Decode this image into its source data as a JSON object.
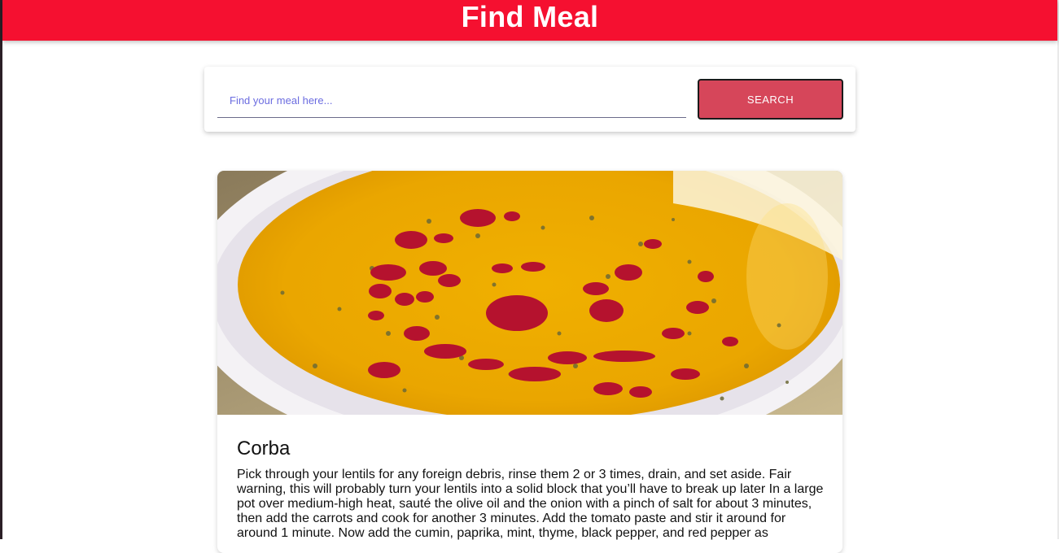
{
  "header": {
    "title": "Find Meal",
    "background_color": "#f51030"
  },
  "search": {
    "placeholder": "Find your meal here...",
    "value": "",
    "button_label": "SEARCH",
    "button_color": "#d6465a"
  },
  "meal": {
    "name": "Corba",
    "image_icon": "lentil-soup-image",
    "instructions": "Pick through your lentils for any foreign debris, rinse them 2 or 3 times, drain, and set aside. Fair warning, this will probably turn your lentils into a solid block that you’ll have to break up later In a large pot over medium-high heat, sauté the olive oil and the onion with a pinch of salt for about 3 minutes, then add the carrots and cook for another 3 minutes. Add the tomato paste and stir it around for around 1 minute. Now add the cumin, paprika, mint, thyme, black pepper, and red pepper as"
  }
}
